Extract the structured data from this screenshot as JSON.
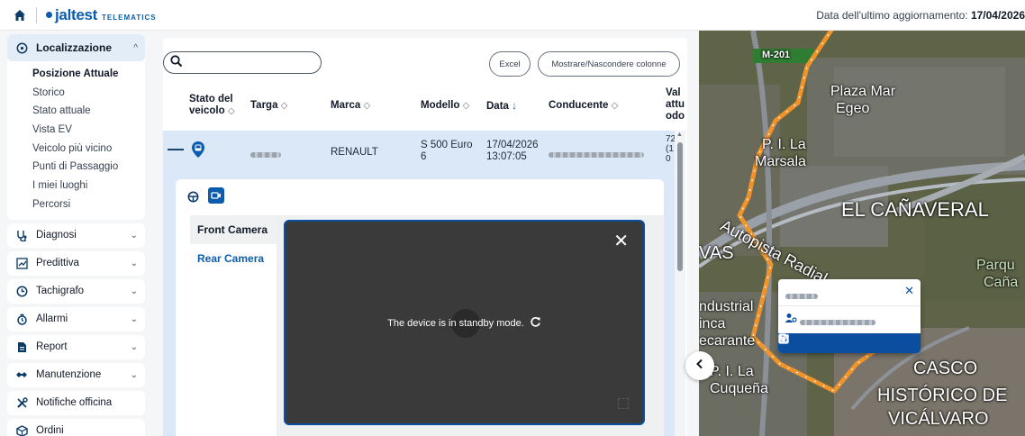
{
  "header": {
    "brand": "jaltest",
    "brand_sub": "TELEMATICS",
    "update_label": "Data dell'ultimo aggiornamento:",
    "update_value": "17/04/2026"
  },
  "sidebar": {
    "active_group": {
      "label": "Localizzazione",
      "items": [
        "Posizione Attuale",
        "Storico",
        "Stato attuale",
        "Vista EV",
        "Veicolo più vicino",
        "Punti di Passaggio",
        "I miei luoghi",
        "Percorsi"
      ],
      "selected_index": 0
    },
    "items": [
      {
        "label": "Diagnosi",
        "icon": "stethoscope-icon"
      },
      {
        "label": "Predittiva",
        "icon": "chart-icon"
      },
      {
        "label": "Tachigrafo",
        "icon": "tachograph-icon"
      },
      {
        "label": "Allarmi",
        "icon": "alarm-icon"
      },
      {
        "label": "Report",
        "icon": "report-icon"
      },
      {
        "label": "Manutenzione",
        "icon": "wrench-icon"
      },
      {
        "label": "Notifiche officina",
        "icon": "tools-icon"
      },
      {
        "label": "Ordini",
        "icon": "box-icon"
      }
    ]
  },
  "toolbar": {
    "search_placeholder": "",
    "excel_label": "Excel",
    "columns_label": "Mostrare/Nascondere colonne"
  },
  "table": {
    "columns": [
      {
        "label_line1": "Stato del",
        "label_line2": "veicolo",
        "sort": "◇"
      },
      {
        "label_line1": "Targa",
        "sort": "◇"
      },
      {
        "label_line1": "Marca",
        "sort": "◇"
      },
      {
        "label_line1": "Modello",
        "sort": "◇"
      },
      {
        "label_line1": "Data",
        "sort": "↓"
      },
      {
        "label_line1": "Conducente",
        "sort": "◇"
      },
      {
        "label_line1": "Val",
        "label_line2": "attu",
        "label_line3": "odo"
      }
    ],
    "row": {
      "expand_symbol": "—",
      "marca": "RENAULT",
      "modello_line1": "S 500 Euro",
      "modello_line2": "6",
      "data_line1": "17/04/2026",
      "data_line2": "13:07:05",
      "val_line1": "72",
      "val_line2": "(1",
      "val_line3": "0"
    }
  },
  "detail": {
    "cameras": [
      "Front Camera",
      "Rear Camera"
    ],
    "selected_camera": 0,
    "standby_message": "The device is in standby mode.",
    "close_symbol": "✕"
  },
  "map": {
    "labels": [
      {
        "text": "M-201"
      },
      {
        "text": "Plaza Mar"
      },
      {
        "text": "Egeo"
      },
      {
        "text": "P. I. La"
      },
      {
        "text": "Marsala"
      },
      {
        "text": "EL CAÑAVERAL"
      },
      {
        "text": "Autopista Radial"
      },
      {
        "text": "VAS"
      },
      {
        "text": "Parqu"
      },
      {
        "text": "Caña"
      },
      {
        "text": "ndustrial"
      },
      {
        "text": "inca"
      },
      {
        "text": "ecarante"
      },
      {
        "text": "P. I. La"
      },
      {
        "text": "Cuqueña"
      },
      {
        "text": "CASCO"
      },
      {
        "text": "HISTÓRICO DE"
      },
      {
        "text": "VICÁLVARO"
      }
    ],
    "route_color": "#f0932b",
    "popup_close": "✕"
  },
  "colors": {
    "accent": "#0b5cad",
    "row_highlight": "#dbe8f7",
    "route": "#f0932b"
  }
}
